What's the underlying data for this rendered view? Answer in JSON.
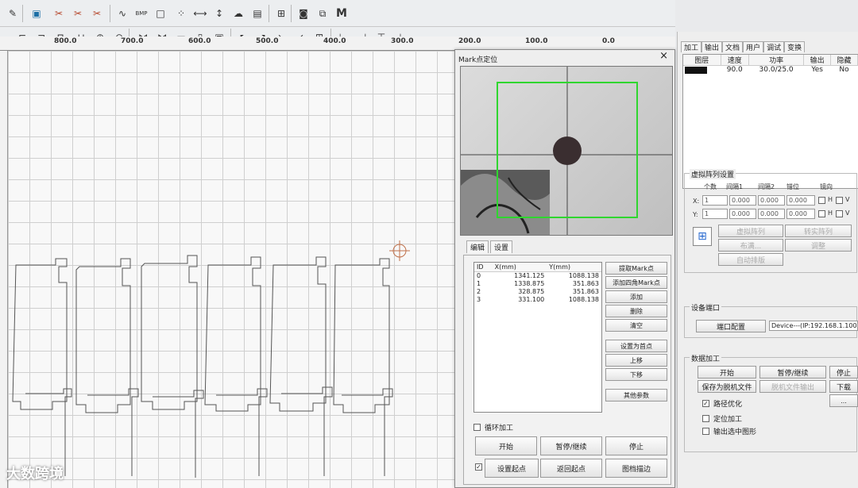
{
  "toolbar": {
    "mode_label": "M",
    "bmp_label": "BMP"
  },
  "ruler": {
    "ticks": [
      "800.0",
      "700.0",
      "600.0",
      "500.0",
      "400.0",
      "300.0",
      "200.0",
      "100.0",
      "0.0"
    ]
  },
  "dialog": {
    "title": "Mark点定位",
    "close": "×",
    "tabs": [
      "编辑",
      "设置"
    ],
    "table": {
      "headers": [
        "ID",
        "X(mm)",
        "Y(mm)"
      ],
      "rows": [
        [
          "0",
          "1341.125",
          "1088.138"
        ],
        [
          "1",
          "1338.875",
          "351.863"
        ],
        [
          "2",
          "328.875",
          "351.863"
        ],
        [
          "3",
          "331.100",
          "1088.138"
        ]
      ]
    },
    "side_buttons": [
      "提取Mark点",
      "添加四角Mark点",
      "添加",
      "删除",
      "清空",
      "设置为首点",
      "上移",
      "下移",
      "其他参数"
    ],
    "loop_label": "循环加工",
    "bottom_buttons": [
      "开始",
      "暂停/继续",
      "停止",
      "设置起点",
      "返回起点",
      "图档描边"
    ]
  },
  "right_panel": {
    "tabs": [
      "加工",
      "输出",
      "文档",
      "用户",
      "调试",
      "变换"
    ],
    "layer_headers": [
      "图层",
      "速度",
      "功率",
      "输出",
      "隐藏"
    ],
    "layer_row": [
      "",
      "90.0",
      "30.0/25.0",
      "Yes",
      "No"
    ],
    "array": {
      "title": "虚拟阵列设置",
      "headers": [
        "个数",
        "间隔1",
        "间隔2",
        "错位",
        "镜向"
      ],
      "x_label": "X:",
      "y_label": "Y:",
      "x_values": [
        "1",
        "0.000",
        "0.000",
        "0.000"
      ],
      "y_values": [
        "1",
        "0.000",
        "0.000",
        "0.000"
      ],
      "mirror_h": "H",
      "mirror_v": "V",
      "buttons": [
        "虚拟阵列",
        "转实阵列",
        "布满...",
        "调整",
        "自动排版"
      ]
    },
    "device": {
      "title": "设备端口",
      "port_button": "端口配置",
      "device_value": "Device---(IP:192.168.1.100)"
    },
    "data": {
      "title": "数据加工",
      "buttons": [
        "开始",
        "暂停/继续",
        "停止",
        "保存为脱机文件",
        "脱机文件输出",
        "下载"
      ],
      "more": "...",
      "checks": [
        "路径优化",
        "定位加工",
        "输出选中图形"
      ]
    }
  },
  "watermark": "大数跨境"
}
